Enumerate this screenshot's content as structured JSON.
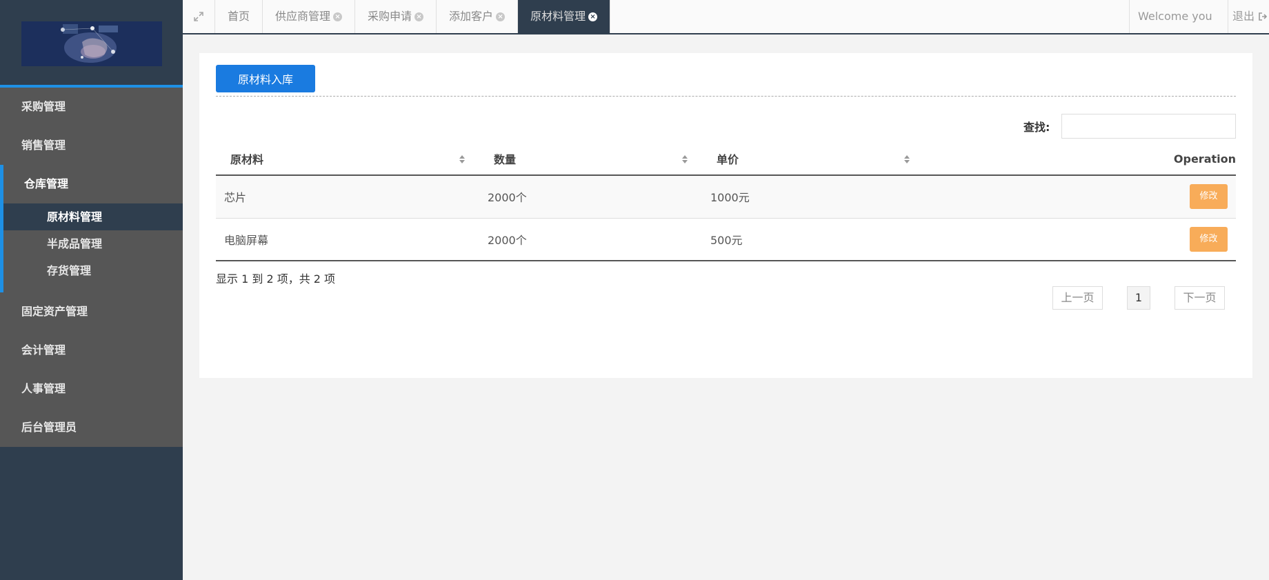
{
  "sidebar": {
    "logo": "system-logo",
    "items": [
      {
        "label": "采购管理"
      },
      {
        "label": "销售管理"
      },
      {
        "label": "仓库管理",
        "children": [
          {
            "label": "原材料管理",
            "active": true
          },
          {
            "label": "半成品管理"
          },
          {
            "label": "存货管理"
          }
        ]
      },
      {
        "label": "固定资产管理"
      },
      {
        "label": "会计管理"
      },
      {
        "label": "人事管理"
      },
      {
        "label": "后台管理员"
      }
    ]
  },
  "topbar": {
    "expand_icon": "expand-icon",
    "tabs": [
      {
        "label": "首页",
        "closable": false
      },
      {
        "label": "供应商管理",
        "closable": true
      },
      {
        "label": "采购申请",
        "closable": true
      },
      {
        "label": "添加客户",
        "closable": true
      },
      {
        "label": "原材料管理",
        "closable": true,
        "active": true
      }
    ],
    "close_glyph": "×",
    "welcome": "Welcome you",
    "logout": "退出"
  },
  "content": {
    "add_button": "原材料入库",
    "search_label": "查找:",
    "search_value": "",
    "table": {
      "headers": [
        "原材料",
        "数量",
        "单价",
        "Operation"
      ],
      "rows": [
        {
          "material": "芯片",
          "quantity": "2000个",
          "price": "1000元",
          "action": "修改"
        },
        {
          "material": "电脑屏幕",
          "quantity": "2000个",
          "price": "500元",
          "action": "修改"
        }
      ]
    },
    "info": "显示 1 到 2 项，共 2 项",
    "pager": {
      "prev": "上一页",
      "current": "1",
      "next": "下一页"
    }
  },
  "colors": {
    "sidebar_bg": "#2f3e4e",
    "menu_bg": "#565656",
    "accent": "#1e90e5",
    "primary_button": "#1a7be0",
    "edit_button": "#f8ac59"
  }
}
